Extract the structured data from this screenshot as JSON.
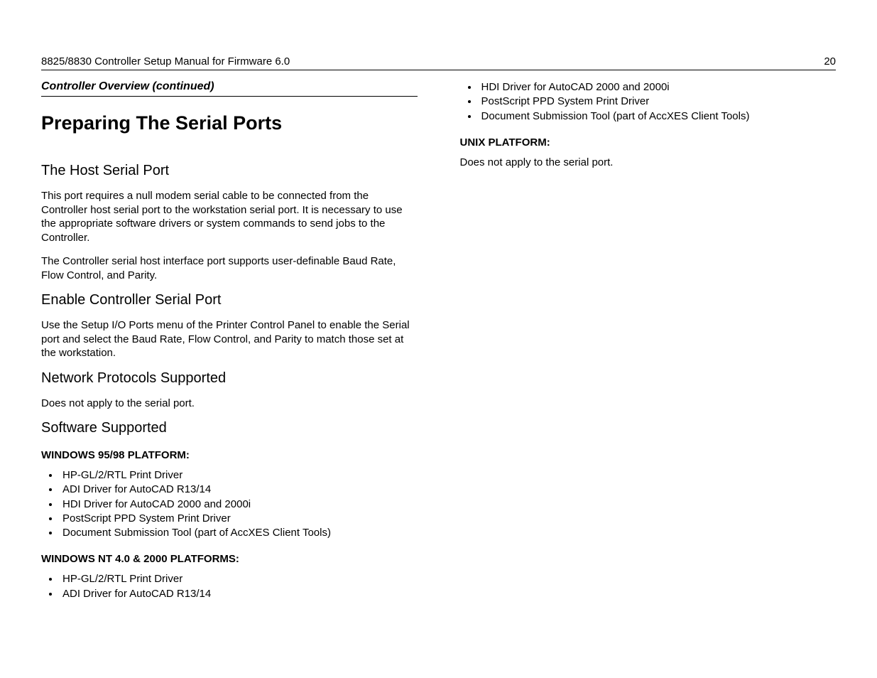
{
  "header": {
    "title": "8825/8830 Controller Setup Manual for Firmware 6.0",
    "page_number": "20"
  },
  "section_continued": "Controller Overview (continued)",
  "main_heading": "Preparing The Serial Ports",
  "host_serial_port": {
    "heading": "The Host Serial Port",
    "p1": "This port requires a null modem serial cable to be connected from the Controller host serial port to the workstation serial port.   It is necessary to use the appropriate software drivers or system commands to send jobs to the Controller.",
    "p2": "The Controller serial host interface port supports user-definable Baud Rate, Flow Control, and Parity."
  },
  "enable_port": {
    "heading": "Enable Controller Serial Port",
    "p1": "Use the Setup I/O Ports menu of the Printer Control Panel to enable the Serial port and select the Baud Rate, Flow Control, and Parity to match those set at the workstation."
  },
  "network_protocols": {
    "heading": "Network Protocols Supported",
    "p1": "Does not apply to the serial port."
  },
  "software_supported": {
    "heading": "Software Supported",
    "win9598": {
      "label": "WINDOWS 95/98 PLATFORM:",
      "items": [
        "HP-GL/2/RTL Print Driver",
        "ADI Driver for AutoCAD R13/14",
        "HDI Driver for AutoCAD 2000 and 2000i",
        "PostScript PPD System Print Driver",
        "Document Submission Tool (part of AccXES Client Tools)"
      ]
    },
    "winnt": {
      "label": "WINDOWS NT 4.0 & 2000 PLATFORMS:",
      "items": [
        "HP-GL/2/RTL Print Driver",
        "ADI Driver for AutoCAD R13/14",
        "HDI Driver for AutoCAD 2000 and 2000i",
        "PostScript PPD System Print Driver",
        "Document Submission Tool (part of AccXES Client Tools)"
      ]
    },
    "unix": {
      "label": "UNIX PLATFORM:",
      "p1": "Does not apply to the serial port."
    }
  }
}
